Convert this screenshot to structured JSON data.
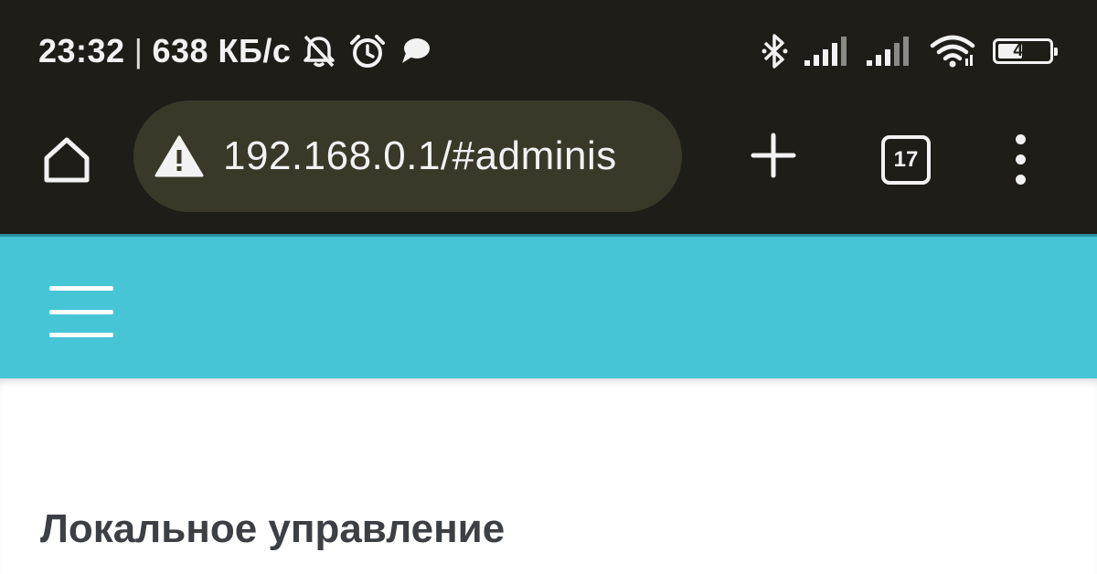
{
  "status_bar": {
    "time": "23:32",
    "separator": "|",
    "net_speed": "638 КБ/с",
    "icons": [
      "muted-bell-icon",
      "alarm-clock-icon",
      "chat-bubble-icon",
      "bluetooth-icon",
      "signal-icon",
      "signal-icon",
      "wifi-icon"
    ],
    "battery_level": "46"
  },
  "browser": {
    "url": "192.168.0.1/#adminis",
    "security_icon": "warning-triangle-icon",
    "tab_count": "17",
    "buttons": [
      "home-icon",
      "plus-icon",
      "tabs-icon",
      "kebab-menu-icon"
    ]
  },
  "app": {
    "header_color": "#45c5d6",
    "menu_icon": "hamburger-icon",
    "page_title": "Локальное управление"
  },
  "colors": {
    "chrome_bg": "#1e1d18",
    "url_bar_bg": "#3a3929",
    "title_text": "#3c3f44"
  }
}
